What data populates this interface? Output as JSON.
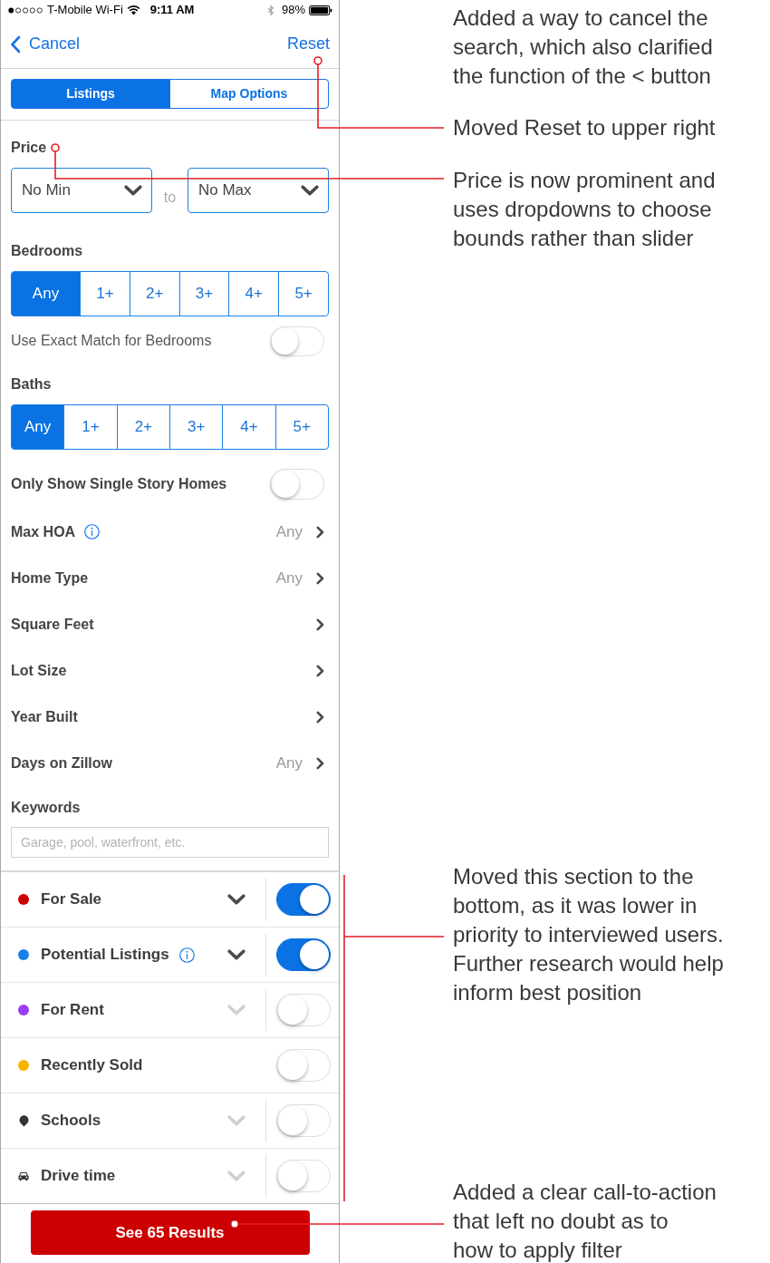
{
  "status_bar": {
    "carrier": "T-Mobile Wi-Fi",
    "time": "9:11 AM",
    "battery": "98%"
  },
  "nav": {
    "cancel": "Cancel",
    "reset": "Reset"
  },
  "tabs": [
    {
      "label": "Listings",
      "selected": true
    },
    {
      "label": "Map Options",
      "selected": false
    }
  ],
  "price": {
    "label": "Price",
    "min": "No Min",
    "separator": "to",
    "max": "No Max"
  },
  "bedrooms": {
    "label": "Bedrooms",
    "options": [
      {
        "label": "Any",
        "selected": true
      },
      {
        "label": "1+",
        "selected": false
      },
      {
        "label": "2+",
        "selected": false
      },
      {
        "label": "3+",
        "selected": false
      },
      {
        "label": "4+",
        "selected": false
      },
      {
        "label": "5+",
        "selected": false
      }
    ]
  },
  "exact_match": {
    "label": "Use Exact Match for Bedrooms",
    "on": false
  },
  "baths": {
    "label": "Baths",
    "options": [
      {
        "label": "Any",
        "selected": true
      },
      {
        "label": "1+",
        "selected": false
      },
      {
        "label": "2+",
        "selected": false
      },
      {
        "label": "3+",
        "selected": false
      },
      {
        "label": "4+",
        "selected": false
      },
      {
        "label": "5+",
        "selected": false
      }
    ]
  },
  "single_story": {
    "label": "Only Show Single Story Homes",
    "on": false
  },
  "filters": [
    {
      "label": "Max HOA",
      "info": true,
      "value": "Any"
    },
    {
      "label": "Home Type",
      "info": false,
      "value": "Any"
    },
    {
      "label": "Square Feet",
      "info": false
    },
    {
      "label": "Lot Size",
      "info": false
    },
    {
      "label": "Year Built",
      "info": false
    },
    {
      "label": "Days on Zillow",
      "info": false,
      "value": "Any"
    }
  ],
  "keywords": {
    "label": "Keywords",
    "placeholder": "Garage, pool, waterfront, etc."
  },
  "layers": [
    {
      "label": "For Sale",
      "kind": "dot",
      "color": "#cc0000",
      "info": false,
      "expandable": true,
      "on": true
    },
    {
      "label": "Potential Listings",
      "kind": "dot",
      "color": "#1a7ee8",
      "info": true,
      "expandable": true,
      "on": true
    },
    {
      "label": "For Rent",
      "kind": "dot",
      "color": "#9b3df2",
      "info": false,
      "expandable": true,
      "on": false
    },
    {
      "label": "Recently Sold",
      "kind": "dot",
      "color": "#f7b500",
      "info": false,
      "expandable": false,
      "on": false
    },
    {
      "label": "Schools",
      "kind": "pin",
      "info": false,
      "expandable": true,
      "on": false
    },
    {
      "label": "Drive time",
      "kind": "car",
      "info": false,
      "expandable": true,
      "on": false
    }
  ],
  "results_button": {
    "label": "See 65 Results"
  },
  "annotations": [
    {
      "lines": [
        "Added a way to cancel the",
        "search, which also clarified",
        "the function of the < button"
      ]
    },
    {
      "lines": [
        "Moved Reset to upper right"
      ]
    },
    {
      "lines": [
        "Price is now prominent and",
        "uses dropdowns to choose",
        "bounds rather than slider"
      ]
    },
    {
      "lines": [
        "Moved this section to the",
        "bottom, as it was lower in",
        "priority to interviewed users.",
        "Further research would help",
        "inform best position"
      ]
    },
    {
      "lines": [
        "Added a clear call-to-action",
        "that left no doubt as to",
        "how to apply filter"
      ]
    }
  ]
}
